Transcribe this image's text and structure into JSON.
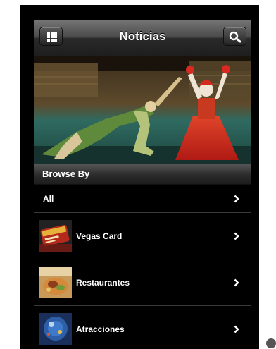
{
  "navbar": {
    "title": "Noticias",
    "left_button_icon": "grid-icon",
    "right_button_icon": "search-icon"
  },
  "hero": {
    "image": "circus-performers-photo"
  },
  "section_header": {
    "label": "Browse By"
  },
  "list": {
    "items": [
      {
        "label": "All",
        "thumb": null
      },
      {
        "label": "Vegas Card",
        "thumb": "vegas-card-thumbnail"
      },
      {
        "label": "Restaurantes",
        "thumb": "restaurant-food-thumbnail"
      },
      {
        "label": "Atracciones",
        "thumb": "attraction-thumbnail"
      }
    ],
    "chevron_icon": "chevron-right-icon"
  },
  "colors": {
    "background": "#000000",
    "text": "#ffffff",
    "navbar_top": "#767676",
    "navbar_bottom": "#1e1e1e"
  }
}
